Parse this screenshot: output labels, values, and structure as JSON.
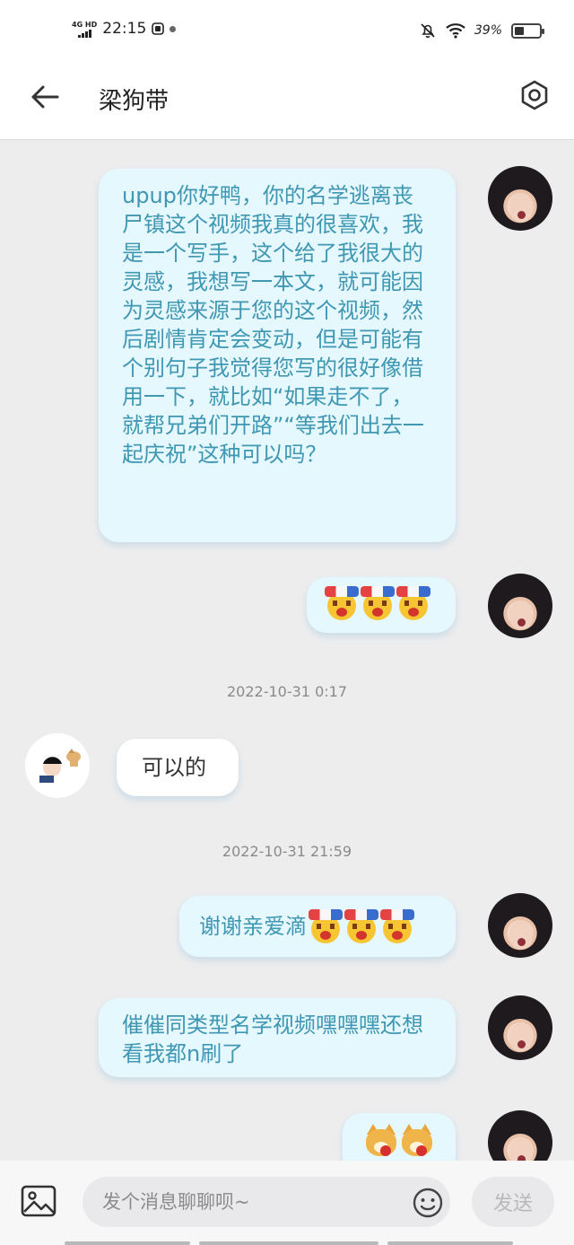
{
  "status_bar": {
    "network": "4G HD",
    "time": "22:15",
    "battery": "39%",
    "battery_fill": 0.39
  },
  "header": {
    "title": "梁狗带",
    "back_icon": "arrow-left-icon",
    "settings_icon": "hexagon-gear-icon"
  },
  "messages": [
    {
      "side": "out",
      "type": "text",
      "text": "upup你好鸭，你的名学逃离丧尸镇这个视频我真的很喜欢，我是一个写手，这个给了我很大的灵感，我想写一本文，就可能因为灵感来源于您的这个视频，然后剧情肯定会变动，但是可能有个别句子我觉得您写的很好像借用一下，就比如“如果走不了，就帮兄弟们开路”“等我们出去一起庆祝”这种可以吗？"
    },
    {
      "side": "out",
      "type": "emoji",
      "text": "[哈欠][哈欠][哈欠]"
    },
    {
      "side": "time",
      "text": "2022-10-31 0:17"
    },
    {
      "side": "in",
      "type": "text",
      "text": "可以的"
    },
    {
      "side": "time",
      "text": "2022-10-31 21:59"
    },
    {
      "side": "out",
      "type": "text_emoji",
      "text": "谢谢亲爱滴"
    },
    {
      "side": "out",
      "type": "text",
      "text": "催催同类型名学视频嘿嘿嘿还想看我都n刷了"
    },
    {
      "side": "out",
      "type": "emoji",
      "text": "[doge][doge]"
    }
  ],
  "input": {
    "placeholder": "发个消息聊聊呗~",
    "send_label": "发送",
    "image_icon": "image-icon",
    "emoji_icon": "smiley-icon"
  }
}
